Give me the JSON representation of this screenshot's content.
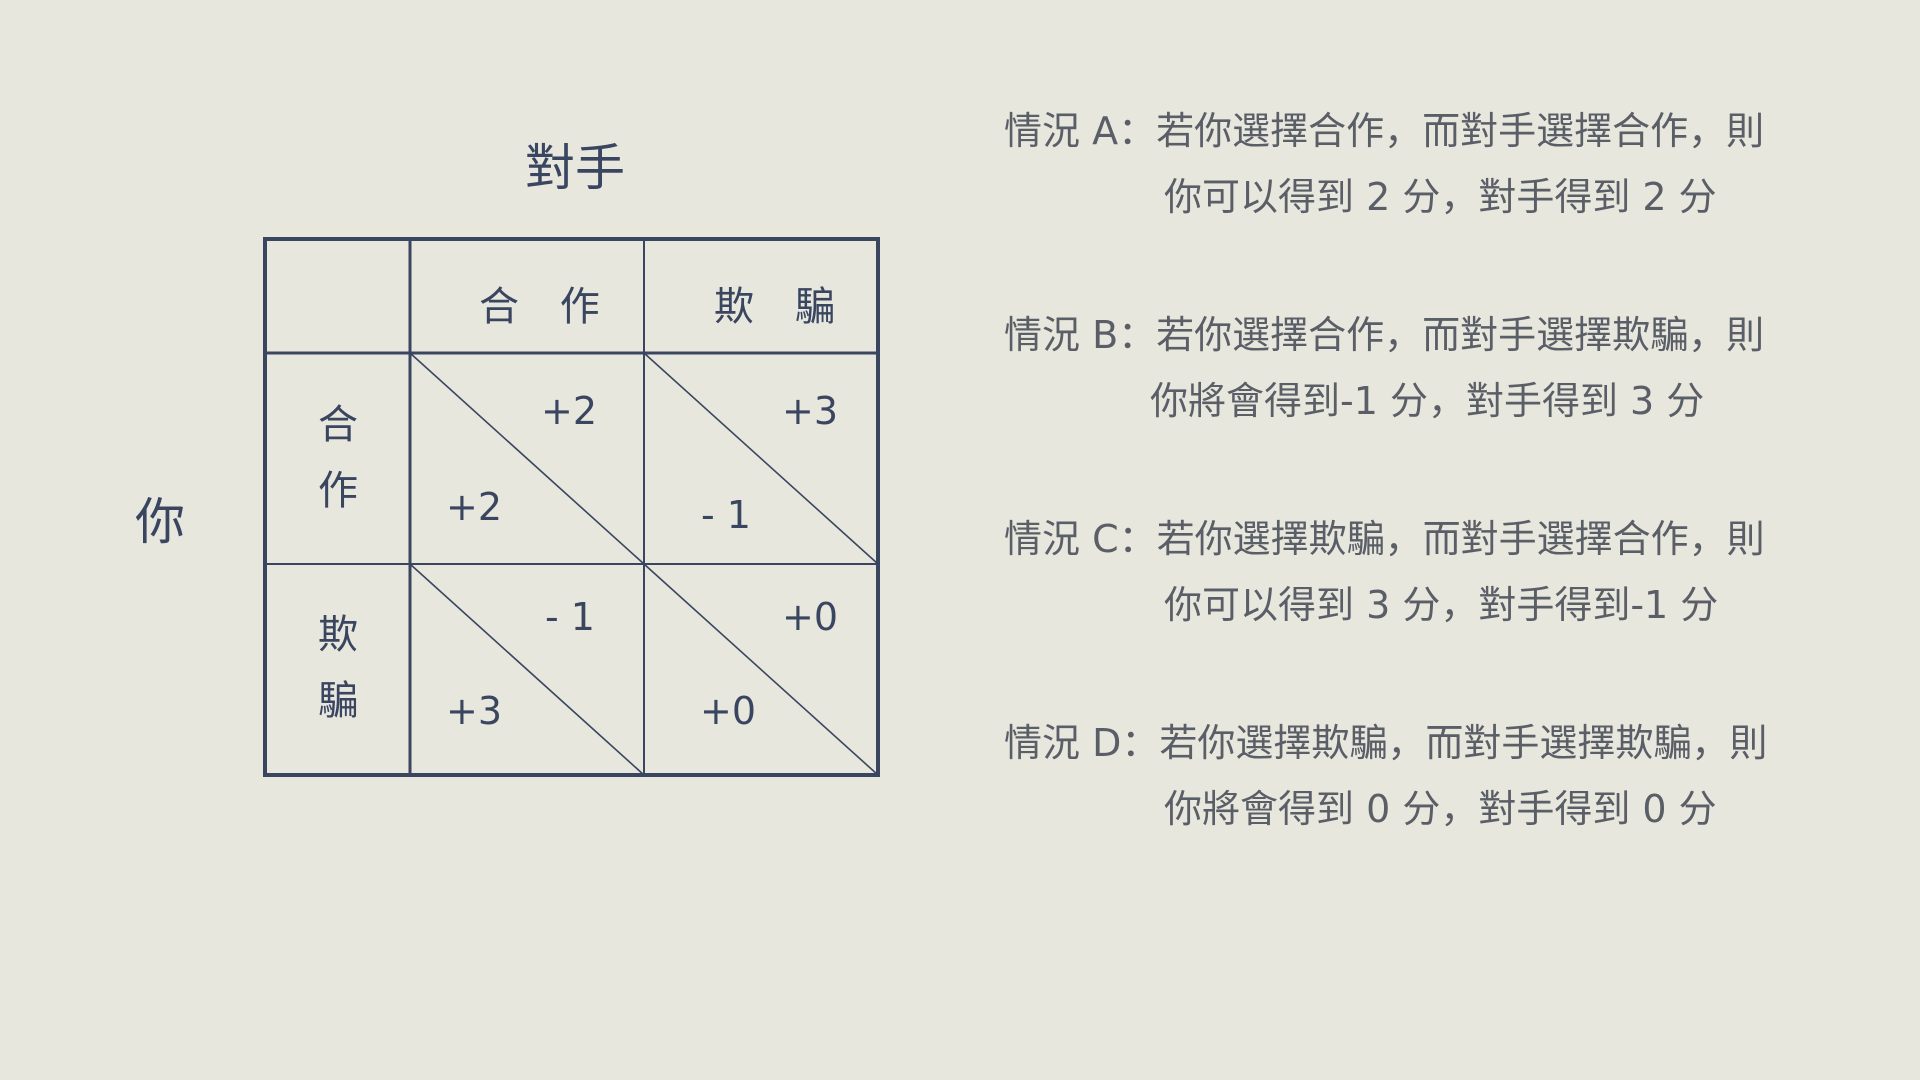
{
  "header": {
    "opponent": "對手",
    "you": "你"
  },
  "matrix": {
    "col_heads": [
      "合 作",
      "欺 騙"
    ],
    "row_heads": [
      [
        "合",
        "作"
      ],
      [
        "欺",
        "騙"
      ]
    ],
    "cells": [
      [
        {
          "opponent": "+2",
          "you": "+2"
        },
        {
          "opponent": "+3",
          "you": "- 1"
        }
      ],
      [
        {
          "opponent": "- 1",
          "you": "+3"
        },
        {
          "opponent": "+0",
          "you": "+0"
        }
      ]
    ]
  },
  "cases": [
    {
      "line1": "情況 A：若你選擇合作，而對手選擇合作，則",
      "line2": "你可以得到 2 分，對手得到 2 分"
    },
    {
      "line1": "情況 B：若你選擇合作，而對手選擇欺騙，則",
      "line2": "你將會得到-1 分，對手得到 3 分"
    },
    {
      "line1": "情況 C：若你選擇欺騙，而對手選擇合作，則",
      "line2": "你可以得到 3 分，對手得到-1 分"
    },
    {
      "line1": "情況 D：若你選擇欺騙，而對手選擇欺騙，則",
      "line2": "你將會得到 0 分，對手得到 0 分"
    }
  ],
  "colors": {
    "background": "#e8e7de",
    "ink": "#3a4560",
    "text_gray": "#5a5e66"
  }
}
